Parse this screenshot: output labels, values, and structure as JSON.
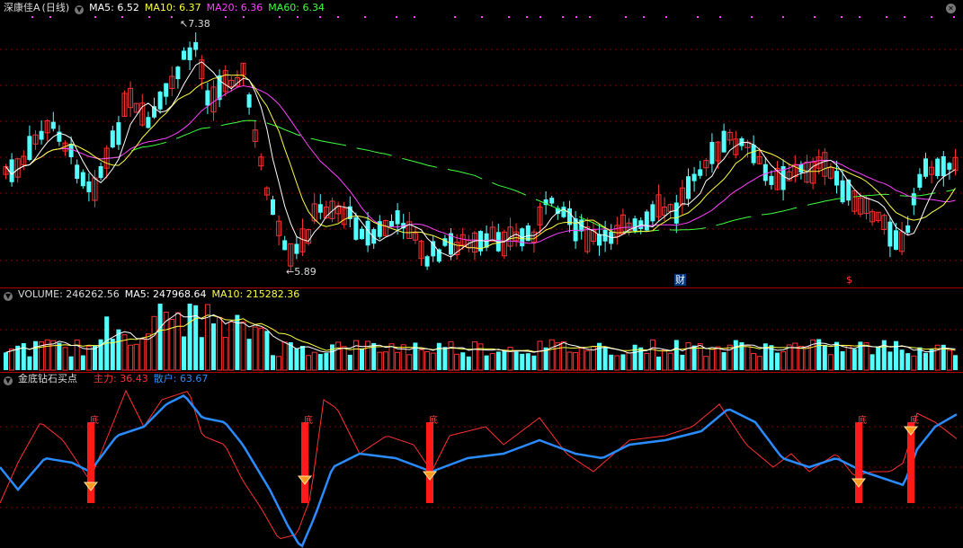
{
  "main": {
    "stock_name": "深康佳A",
    "period": "(日线)",
    "ma": [
      {
        "label": "MA5:",
        "value": "6.52",
        "color": "#ffffff"
      },
      {
        "label": "MA10:",
        "value": "6.37",
        "color": "#ffff40"
      },
      {
        "label": "MA20:",
        "value": "6.36",
        "color": "#ff40ff"
      },
      {
        "label": "MA60:",
        "value": "6.34",
        "color": "#40ff40"
      }
    ],
    "high_label": "7.38",
    "low_label": "5.89",
    "marker_cai": "财",
    "marker_s": "$"
  },
  "volume": {
    "label": "VOLUME:",
    "value": "246262.56",
    "ma5_label": "MA5:",
    "ma5_value": "247968.64",
    "ma10_label": "MA10:",
    "ma10_value": "215282.36"
  },
  "indicator": {
    "name": "金底钻石买点",
    "zl_label": "主力:",
    "zl_value": "36.43",
    "sh_label": "散户:",
    "sh_value": "63.67",
    "bottom_mark": "底"
  },
  "colors": {
    "up": "#ff3232",
    "down": "#54ffff",
    "ma5": "#ffffff",
    "ma10": "#ffff40",
    "ma20": "#ff40ff",
    "ma60": "#40ff40",
    "zl": "#ff3030",
    "sh": "#2a8cff",
    "grid": "#8a0000"
  },
  "chart_data": {
    "type": "candlestick",
    "price_range": [
      5.6,
      7.6
    ],
    "high": 7.38,
    "low": 5.89
  }
}
